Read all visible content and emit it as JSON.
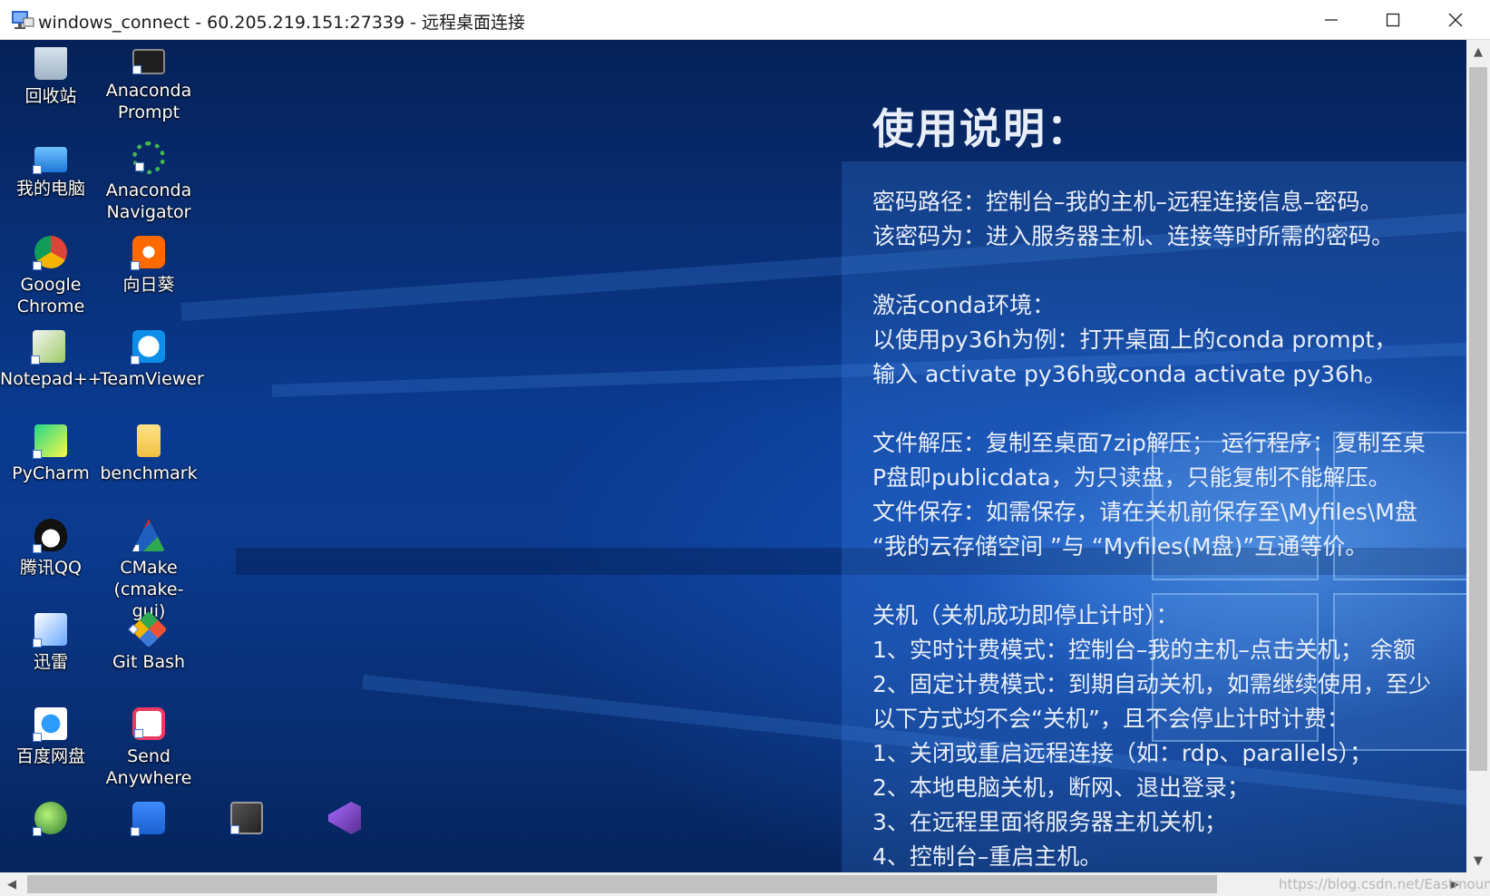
{
  "window": {
    "title": "windows_connect - 60.205.219.151:27339 - 远程桌面连接",
    "minimize": "—",
    "maximize": "☐",
    "close": "✕"
  },
  "desktop_icons": {
    "recycle_bin": "回收站",
    "anaconda_prompt": "Anaconda Prompt",
    "my_computer": "我的电脑",
    "anaconda_navigator": "Anaconda Navigator",
    "google_chrome": "Google Chrome",
    "sunlogin": "向日葵",
    "notepadpp": "Notepad++",
    "teamviewer": "TeamViewer",
    "pycharm": "PyCharm",
    "benchmark": "benchmark",
    "qq": "腾讯QQ",
    "cmake": "CMake (cmake-gui)",
    "xunlei": "迅雷",
    "git_bash": "Git Bash",
    "baidu_netdisk": "百度网盘",
    "send_anywhere": "Send Anywhere"
  },
  "notes": {
    "heading": "使用说明：",
    "lines": [
      "密码路径：控制台–我的主机–远程连接信息–密码。",
      "该密码为：进入服务器主机、连接等时所需的密码。",
      "",
      "激活conda环境：",
      "以使用py36h为例：打开桌面上的conda prompt，",
      "输入 activate py36h或conda activate py36h。",
      "",
      "文件解压：复制至桌面7zip解压；  运行程序：复制至桌",
      "P盘即publicdata，为只读盘，只能复制不能解压。",
      "文件保存：如需保存，请在关机前保存至\\Myfiles\\M盘",
      "“我的云存储空间 ”与 “Myfiles(M盘)”互通等价。",
      "",
      "关机（关机成功即停止计时）：",
      "1、实时计费模式：控制台–我的主机–点击关机；  余额",
      "2、固定计费模式：到期自动关机，如需继续使用，至少",
      "以下方式均不会“关机”，且不会停止计时计费：",
      "1、关闭或重启远程连接（如：rdp、parallels）；",
      "2、本地电脑关机，断网、退出登录；",
      "3、在远程里面将服务器主机关机；",
      "4、控制台–重启主机。"
    ]
  },
  "scrollbars": {
    "up": "▲",
    "down": "▼",
    "left": "◀",
    "right": "▶"
  },
  "watermark": "https://blog.csdn.net/Eastmount",
  "colors": {
    "desktop_dark": "#062157",
    "desktop_mid": "#0a3a8f",
    "notes_text": "#e8eef8",
    "titlebar_bg": "#ffffff"
  }
}
